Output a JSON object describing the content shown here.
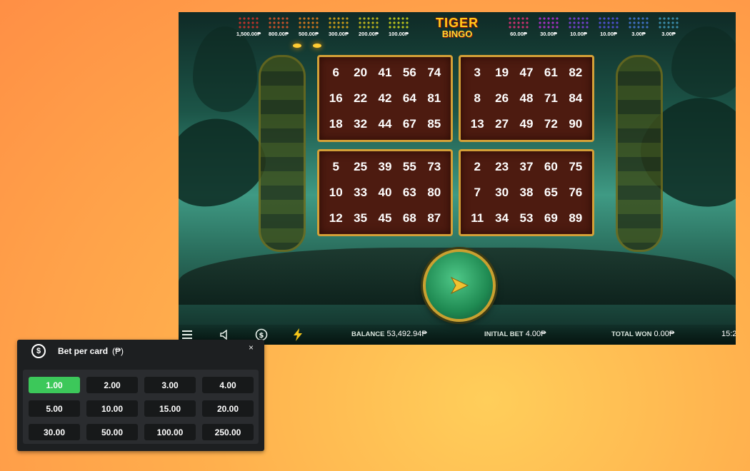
{
  "game": {
    "logo_line1": "TIGER",
    "logo_line2": "BINGO",
    "prizes_left": [
      {
        "value": "1,500.00₱",
        "color": "#b8332a"
      },
      {
        "value": "800.00₱",
        "color": "#c2512a"
      },
      {
        "value": "500.00₱",
        "color": "#c9741e"
      },
      {
        "value": "300.00₱",
        "color": "#c49a1a"
      },
      {
        "value": "200.00₱",
        "color": "#b8b01e"
      },
      {
        "value": "100.00₱",
        "color": "#b8c01e"
      }
    ],
    "prizes_right": [
      {
        "value": "60.00₱",
        "color": "#c83070"
      },
      {
        "value": "30.00₱",
        "color": "#a030c0"
      },
      {
        "value": "10.00₱",
        "color": "#7040c8"
      },
      {
        "value": "10.00₱",
        "color": "#4c4ec8"
      },
      {
        "value": "3.00₱",
        "color": "#3f6ec0"
      },
      {
        "value": "3.00₱",
        "color": "#3a8aa8"
      }
    ],
    "cards": [
      {
        "numbers": [
          "6",
          "20",
          "41",
          "56",
          "74",
          "16",
          "22",
          "42",
          "64",
          "81",
          "18",
          "32",
          "44",
          "67",
          "85"
        ]
      },
      {
        "numbers": [
          "3",
          "19",
          "47",
          "61",
          "82",
          "8",
          "26",
          "48",
          "71",
          "84",
          "13",
          "27",
          "49",
          "72",
          "90"
        ]
      },
      {
        "numbers": [
          "5",
          "25",
          "39",
          "55",
          "73",
          "10",
          "33",
          "40",
          "63",
          "80",
          "12",
          "35",
          "45",
          "68",
          "87"
        ]
      },
      {
        "numbers": [
          "2",
          "23",
          "37",
          "60",
          "75",
          "7",
          "30",
          "38",
          "65",
          "76",
          "11",
          "34",
          "53",
          "69",
          "89"
        ]
      }
    ],
    "bottom": {
      "balance_label": "BALANCE",
      "balance_value": "53,492.94₱",
      "initial_bet_label": "INITIAL BET",
      "initial_bet_value": "4.00₱",
      "total_won_label": "TOTAL WON",
      "total_won_value": "0.00₱",
      "clock": "15:2"
    }
  },
  "bet_panel": {
    "title": "Bet per card",
    "currency": "(₱)",
    "coin_glyph": "$",
    "close_glyph": "×",
    "options": [
      "1.00",
      "2.00",
      "3.00",
      "4.00",
      "5.00",
      "10.00",
      "15.00",
      "20.00",
      "30.00",
      "50.00",
      "100.00",
      "250.00"
    ],
    "selected": "1.00",
    "selected_color": "#3cc85a"
  }
}
